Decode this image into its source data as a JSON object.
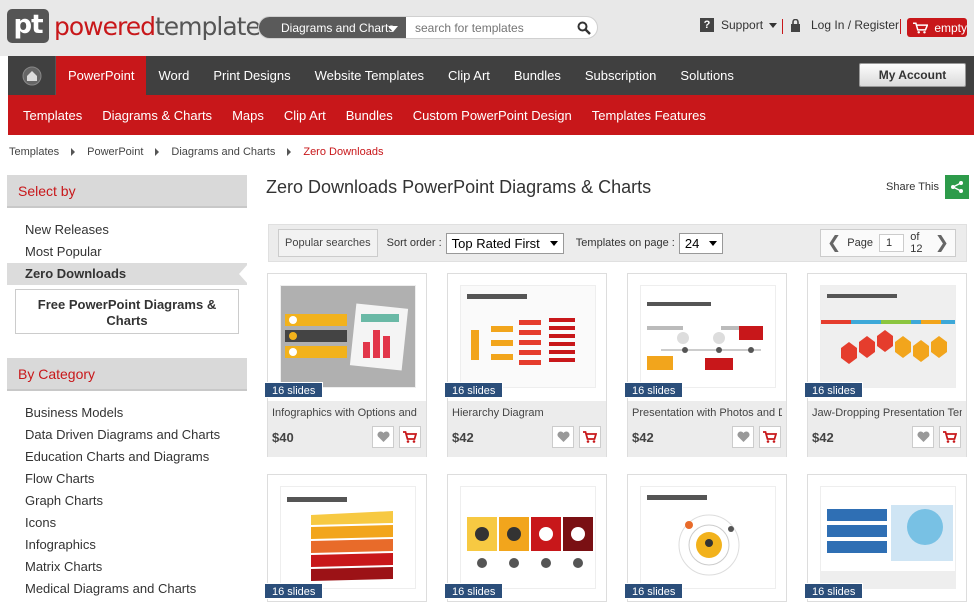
{
  "header": {
    "logo_mark": "pt",
    "logo_word_a": "powered",
    "logo_word_b": "template",
    "search_category": "Diagrams and Charts",
    "search_placeholder": "search for templates",
    "support_label": "Support",
    "login_label": "Log In / Register",
    "cart_label": "empty"
  },
  "nav_primary": {
    "items": [
      "PowerPoint",
      "Word",
      "Print Designs",
      "Website Templates",
      "Clip Art",
      "Bundles",
      "Subscription",
      "Solutions"
    ],
    "active": "PowerPoint",
    "account_label": "My Account"
  },
  "nav_secondary": {
    "items": [
      "Templates",
      "Diagrams & Charts",
      "Maps",
      "Clip Art",
      "Bundles",
      "Custom PowerPoint Design",
      "Templates Features"
    ]
  },
  "breadcrumb": {
    "items": [
      "Templates",
      "PowerPoint",
      "Diagrams and Charts"
    ],
    "current": "Zero Downloads"
  },
  "sidebar": {
    "select_title": "Select by",
    "select_items": [
      "New Releases",
      "Most Popular",
      "Zero Downloads"
    ],
    "free_box": "Free PowerPoint Diagrams & Charts",
    "category_title": "By Category",
    "category_items": [
      "Business Models",
      "Data Driven Diagrams and Charts",
      "Education Charts and Diagrams",
      "Flow Charts",
      "Graph Charts",
      "Icons",
      "Infographics",
      "Matrix Charts",
      "Medical Diagrams and Charts"
    ]
  },
  "main": {
    "title": "Zero Downloads PowerPoint Diagrams & Charts",
    "share_label": "Share This",
    "popular_searches": "Popular searches",
    "sort_label": "Sort order :",
    "sort_value": "Top Rated First",
    "per_page_label": "Templates on page :",
    "per_page_value": "24",
    "page_label": "Page",
    "page_value": "1",
    "page_total": "of 12"
  },
  "cards": [
    {
      "badge": "16 slides",
      "title": "Infographics with Options and",
      "price": "$40"
    },
    {
      "badge": "16 slides",
      "title": "Hierarchy Diagram",
      "price": "$42"
    },
    {
      "badge": "16 slides",
      "title": "Presentation with Photos and D",
      "price": "$42"
    },
    {
      "badge": "16 slides",
      "title": "Jaw-Dropping Presentation Tem",
      "price": "$42"
    },
    {
      "badge": "16 slides"
    },
    {
      "badge": "16 slides"
    },
    {
      "badge": "16 slides"
    },
    {
      "badge": "16 slides"
    }
  ],
  "colors": {
    "brand_red": "#c8171a",
    "nav_dark": "#404040",
    "badge_blue": "#2b4e7a",
    "share_green": "#2d9b4a"
  },
  "icons": [
    "home-icon",
    "search-icon",
    "question-icon",
    "lock-icon",
    "cart-icon",
    "share-icon",
    "heart-icon",
    "chevron-left-icon",
    "chevron-right-icon"
  ]
}
